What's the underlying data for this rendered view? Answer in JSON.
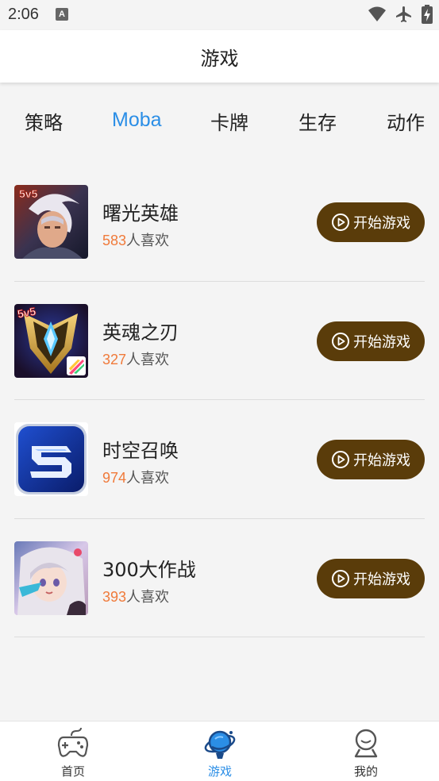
{
  "status_bar": {
    "time": "2:06",
    "notification_badge": "A"
  },
  "header": {
    "title": "游戏"
  },
  "tabs": [
    {
      "label": "策略",
      "active": false
    },
    {
      "label": "Moba",
      "active": true
    },
    {
      "label": "卡牌",
      "active": false
    },
    {
      "label": "生存",
      "active": false
    },
    {
      "label": "动作",
      "active": false
    }
  ],
  "games": [
    {
      "name": "曙光英雄",
      "likes": "583",
      "likes_suffix": "人喜欢",
      "button": "开始游戏",
      "icon": "shuguang-yingxiong-icon"
    },
    {
      "name": "英魂之刃",
      "likes": "327",
      "likes_suffix": "人喜欢",
      "button": "开始游戏",
      "icon": "yinghun-zhiren-icon"
    },
    {
      "name": "时空召唤",
      "likes": "974",
      "likes_suffix": "人喜欢",
      "button": "开始游戏",
      "icon": "shikong-zhaohuan-icon"
    },
    {
      "name": "300大作战",
      "likes": "393",
      "likes_suffix": "人喜欢",
      "button": "开始游戏",
      "icon": "300-dazuozhan-icon"
    }
  ],
  "bottom_nav": [
    {
      "label": "首页",
      "icon": "gamepad-icon",
      "active": false
    },
    {
      "label": "游戏",
      "icon": "planet-icon",
      "active": true
    },
    {
      "label": "我的",
      "icon": "person-icon",
      "active": false
    }
  ],
  "colors": {
    "accent": "#2b8ee6",
    "button_bg": "#5a3c0a",
    "likes_number": "#f07a3a",
    "background": "#f4f4f4"
  }
}
